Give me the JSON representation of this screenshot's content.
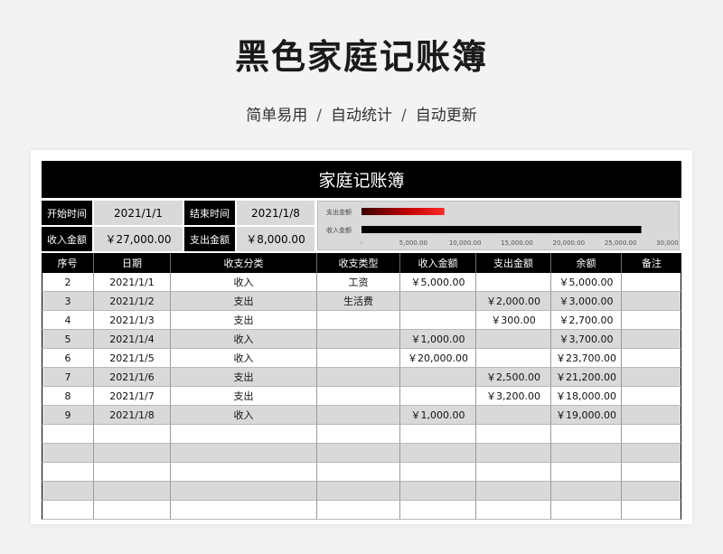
{
  "hero": {
    "title": "黑色家庭记账簿",
    "subtitle_parts": [
      "简单易用",
      "自动统计",
      "自动更新"
    ],
    "separator": "/"
  },
  "sheet": {
    "title": "家庭记账簿",
    "summary": {
      "start_label": "开始时间",
      "start_value": "2021/1/1",
      "end_label": "结束时间",
      "end_value": "2021/1/8",
      "income_label": "收入金额",
      "income_value": "￥27,000.00",
      "expense_label": "支出金额",
      "expense_value": "￥8,000.00"
    },
    "columns": [
      "序号",
      "日期",
      "收支分类",
      "收支类型",
      "收入金额",
      "支出金额",
      "余额",
      "备注"
    ],
    "rows": [
      [
        "2",
        "2021/1/1",
        "收入",
        "工资",
        "￥5,000.00",
        "",
        "￥5,000.00",
        ""
      ],
      [
        "3",
        "2021/1/2",
        "支出",
        "生活费",
        "",
        "￥2,000.00",
        "￥3,000.00",
        ""
      ],
      [
        "4",
        "2021/1/3",
        "支出",
        "",
        "",
        "￥300.00",
        "￥2,700.00",
        ""
      ],
      [
        "5",
        "2021/1/4",
        "收入",
        "",
        "￥1,000.00",
        "",
        "￥3,700.00",
        ""
      ],
      [
        "6",
        "2021/1/5",
        "收入",
        "",
        "￥20,000.00",
        "",
        "￥23,700.00",
        ""
      ],
      [
        "7",
        "2021/1/6",
        "支出",
        "",
        "",
        "￥2,500.00",
        "￥21,200.00",
        ""
      ],
      [
        "8",
        "2021/1/7",
        "支出",
        "",
        "",
        "￥3,200.00",
        "￥18,000.00",
        ""
      ],
      [
        "9",
        "2021/1/8",
        "收入",
        "",
        "￥1,000.00",
        "",
        "￥19,000.00",
        ""
      ],
      [
        "",
        "",
        "",
        "",
        "",
        "",
        "",
        ""
      ],
      [
        "",
        "",
        "",
        "",
        "",
        "",
        "",
        ""
      ],
      [
        "",
        "",
        "",
        "",
        "",
        "",
        "",
        ""
      ],
      [
        "",
        "",
        "",
        "",
        "",
        "",
        "",
        ""
      ],
      [
        "",
        "",
        "",
        "",
        "",
        "",
        "",
        ""
      ]
    ]
  },
  "chart_data": {
    "type": "bar",
    "orientation": "horizontal",
    "categories": [
      "支出金额",
      "收入金额"
    ],
    "values": [
      8000,
      27000
    ],
    "colors": [
      "#c00000",
      "#000000"
    ],
    "xlim": [
      0,
      30000
    ],
    "xticks": [
      "-",
      "5,000.00",
      "10,000.00",
      "15,000.00",
      "20,000.00",
      "25,000.00",
      "30,000.00"
    ],
    "grid": false
  }
}
